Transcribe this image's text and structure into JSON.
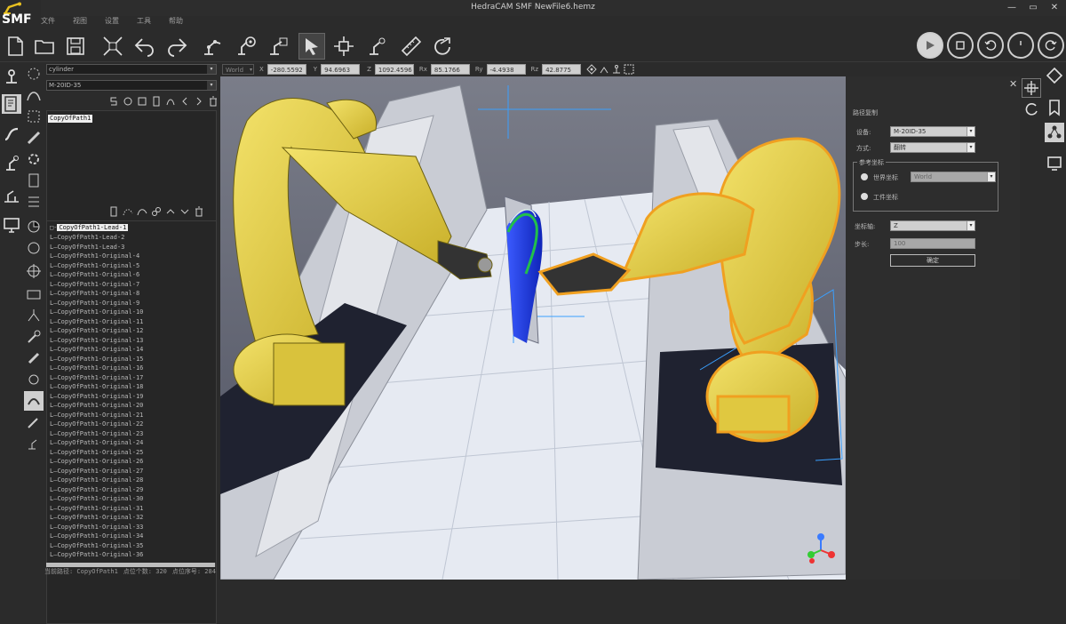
{
  "app": {
    "logo_text": "SMF",
    "window_title": "HedraCAM SMF  NewFile6.hemz",
    "window_controls": [
      "—",
      "▭",
      "✕"
    ]
  },
  "menu": [
    "文件",
    "视图",
    "设置",
    "工具",
    "帮助"
  ],
  "toolbar": {
    "icons": [
      "new-file-icon",
      "open-folder-icon",
      "save-icon",
      "fit-view-icon",
      "undo-icon",
      "redo-icon",
      "robot-path-icon",
      "robot-settings-icon",
      "robot-point-icon",
      "select-cursor-icon",
      "move-axis-icon",
      "robot-arm-icon",
      "ruler-icon",
      "rotate-icon"
    ],
    "right_controls": [
      "play-icon",
      "stop-icon",
      "rewind-icon",
      "clock-icon",
      "reset-icon"
    ]
  },
  "left_panel": {
    "combo1": "cylinder",
    "combo2": "M-20ID-35",
    "path_list": [
      "CopyOfPath1"
    ],
    "tree_root": "CopyOfPath1-Lead-1",
    "tree_items": [
      "CopyOfPath1-Lead-2",
      "CopyOfPath1-Lead-3",
      "CopyOfPath1-Original-4",
      "CopyOfPath1-Original-5",
      "CopyOfPath1-Original-6",
      "CopyOfPath1-Original-7",
      "CopyOfPath1-Original-8",
      "CopyOfPath1-Original-9",
      "CopyOfPath1-Original-10",
      "CopyOfPath1-Original-11",
      "CopyOfPath1-Original-12",
      "CopyOfPath1-Original-13",
      "CopyOfPath1-Original-14",
      "CopyOfPath1-Original-15",
      "CopyOfPath1-Original-16",
      "CopyOfPath1-Original-17",
      "CopyOfPath1-Original-18",
      "CopyOfPath1-Original-19",
      "CopyOfPath1-Original-20",
      "CopyOfPath1-Original-21",
      "CopyOfPath1-Original-22",
      "CopyOfPath1-Original-23",
      "CopyOfPath1-Original-24",
      "CopyOfPath1-Original-25",
      "CopyOfPath1-Original-26",
      "CopyOfPath1-Original-27",
      "CopyOfPath1-Original-28",
      "CopyOfPath1-Original-29",
      "CopyOfPath1-Original-30",
      "CopyOfPath1-Original-31",
      "CopyOfPath1-Original-32",
      "CopyOfPath1-Original-33",
      "CopyOfPath1-Original-34",
      "CopyOfPath1-Original-35",
      "CopyOfPath1-Original-36"
    ],
    "status": {
      "path_label": "当前路径: CopyOfPath1",
      "points_label": "点位个数: 320",
      "index_label": "点位序号: 284"
    }
  },
  "coords": {
    "frame": "World",
    "x_label": "X",
    "x": "-280.5592",
    "y_label": "Y",
    "y": "94.6963",
    "z_label": "Z",
    "z": "1092.4596",
    "rx_label": "Rx",
    "rx": "85.1766",
    "ry_label": "Ry",
    "ry": "-4.4938",
    "rz_label": "Rz",
    "rz": "42.8775"
  },
  "right_panel": {
    "title": "路径复制",
    "device_label": "设备:",
    "device_value": "M-20ID-35",
    "mode_label": "方式:",
    "mode_value": "翻转",
    "group_label": "参考坐标",
    "radio1_label": "世界坐标",
    "radio1_value": "World",
    "radio2_label": "工件坐标",
    "axis_label": "坐标轴:",
    "axis_value": "Z",
    "step_label": "步长:",
    "step_value": "100",
    "confirm_label": "确定",
    "close": "✕"
  },
  "colors": {
    "robot_yellow": "#e8d23a",
    "highlight_orange": "#f0a020",
    "path_blue": "#1a3ad8",
    "path_green": "#2ec24a",
    "floor": "#e8ecf3"
  }
}
